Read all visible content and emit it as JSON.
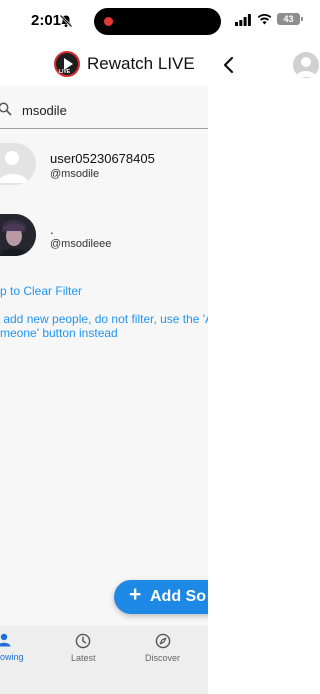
{
  "status_bar": {
    "time": "2:01",
    "battery": "43"
  },
  "header": {
    "title": "Rewatch LIVE"
  },
  "search": {
    "value": "msodile"
  },
  "users": [
    {
      "name": "user05230678405",
      "handle": "@msodile"
    },
    {
      "name": ".",
      "handle": "@msodileee"
    }
  ],
  "clear_filter": "p to Clear Filter",
  "hint": {
    "line1": " add new people, do not filter, use the 'A",
    "line2": "meone' button instead"
  },
  "fab": {
    "label": "Add So"
  },
  "bottom_nav": {
    "following": "owing",
    "latest": "Latest",
    "discover": "Discover"
  },
  "colors": {
    "accent": "#2196f3",
    "fab": "#1e88e5",
    "active_nav": "#1e6fd9"
  }
}
